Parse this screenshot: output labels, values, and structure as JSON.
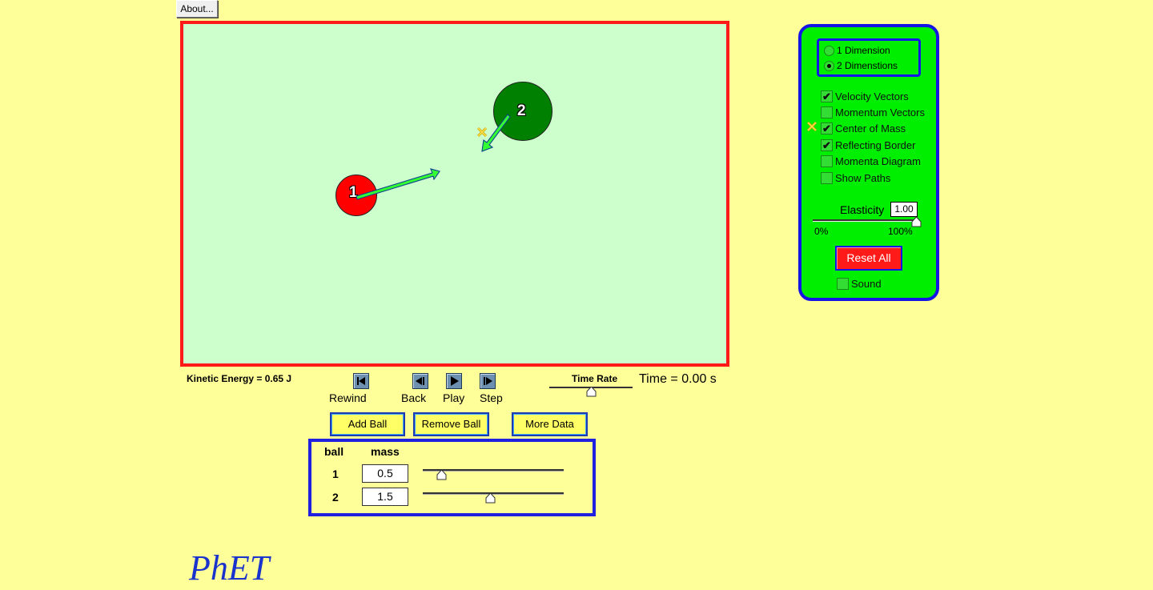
{
  "about_label": "About...",
  "arena": {
    "balls": [
      {
        "label": "1",
        "color": "#ff0000"
      },
      {
        "label": "2",
        "color": "#008000"
      }
    ],
    "arrow_color": "#33ff33"
  },
  "kinetic_energy": "Kinetic Energy = 0.65 J",
  "transport": {
    "rewind": "Rewind",
    "back": "Back",
    "play": "Play",
    "step": "Step"
  },
  "time_rate_label": "Time Rate",
  "time_rate_fraction": 0.5,
  "time_readout": "Time = 0.00 s",
  "buttons": {
    "add_ball": "Add Ball",
    "remove_ball": "Remove Ball",
    "more_data": "More Data"
  },
  "mass_table": {
    "header_ball": "ball",
    "header_mass": "mass",
    "rows": [
      {
        "ball": "1",
        "mass": "0.5",
        "slider_fraction": 0.13
      },
      {
        "ball": "2",
        "mass": "1.5",
        "slider_fraction": 0.48
      }
    ]
  },
  "logo": "PhET",
  "controls": {
    "dimension_options": [
      {
        "label": "1 Dimension",
        "selected": false
      },
      {
        "label": "2 Dimenstions",
        "selected": true
      }
    ],
    "checkboxes": [
      {
        "label": "Velocity Vectors",
        "checked": true
      },
      {
        "label": "Momentum Vectors",
        "checked": false
      },
      {
        "label": "Center of Mass",
        "checked": true
      },
      {
        "label": "Reflecting Border",
        "checked": true
      },
      {
        "label": "Momenta Diagram",
        "checked": false
      },
      {
        "label": "Show Paths",
        "checked": false
      }
    ],
    "elasticity_label": "Elasticity",
    "elasticity_value": "1.00",
    "elasticity_min": "0%",
    "elasticity_max": "100%",
    "reset_label": "Reset All",
    "sound_label": "Sound",
    "sound_checked": false
  }
}
